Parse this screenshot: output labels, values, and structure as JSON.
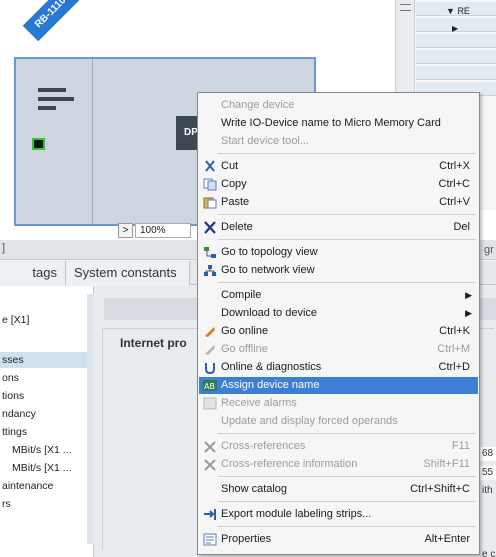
{
  "device_view": {
    "badge": "RB-1110",
    "dp_chip": "DP-",
    "zoom": {
      "next_icon": ">",
      "value": "100%"
    }
  },
  "overview": {
    "header_text": "RE",
    "header_icon": "triangle-down",
    "row_icon": "triangle-right"
  },
  "inspector": {
    "top_mark": "]",
    "right_mark": "gr",
    "tabs": [
      {
        "label": "tags"
      },
      {
        "label": "System constants"
      }
    ],
    "nav": {
      "items": [
        {
          "label": "e [X1]"
        },
        {
          "label": "sses"
        },
        {
          "label": "ons"
        },
        {
          "label": "tions"
        },
        {
          "label": "ndancy"
        },
        {
          "label": "ttings"
        },
        {
          "label": "MBit/s [X1 ..."
        },
        {
          "label": "MBit/s [X1 ..."
        },
        {
          "label": "aintenance"
        },
        {
          "label": "rs"
        }
      ]
    },
    "content": {
      "section_title": "Internet pro",
      "right_fragments": [
        "68",
        "55",
        "ith",
        "e c"
      ]
    }
  },
  "context_menu": {
    "items": [
      {
        "label": "Change device",
        "enabled": false
      },
      {
        "label": "Write IO-Device name to Micro Memory Card",
        "enabled": true
      },
      {
        "label": "Start device tool...",
        "enabled": false
      },
      {
        "label": "Cut",
        "shortcut": "Ctrl+X",
        "icon": "cut-icon",
        "enabled": true
      },
      {
        "label": "Copy",
        "shortcut": "Ctrl+C",
        "icon": "copy-icon",
        "enabled": true
      },
      {
        "label": "Paste",
        "shortcut": "Ctrl+V",
        "icon": "paste-icon",
        "enabled": true
      },
      {
        "label": "Delete",
        "shortcut": "Del",
        "icon": "delete-icon",
        "enabled": true
      },
      {
        "label": "Go to topology view",
        "icon": "topology-icon",
        "enabled": true
      },
      {
        "label": "Go to network view",
        "icon": "network-icon",
        "enabled": true
      },
      {
        "label": "Compile",
        "submenu": true,
        "enabled": true
      },
      {
        "label": "Download to device",
        "submenu": true,
        "enabled": true
      },
      {
        "label": "Go online",
        "shortcut": "Ctrl+K",
        "icon": "go-online-icon",
        "enabled": true
      },
      {
        "label": "Go offline",
        "shortcut": "Ctrl+M",
        "icon": "go-offline-icon",
        "enabled": false
      },
      {
        "label": "Online & diagnostics",
        "shortcut": "Ctrl+D",
        "icon": "diagnostics-icon",
        "enabled": true
      },
      {
        "label": "Assign device name",
        "icon": "assign-name-icon",
        "enabled": true,
        "highlighted": true
      },
      {
        "label": "Receive alarms",
        "icon": "alarm-icon",
        "enabled": false
      },
      {
        "label": "Update and display forced operands",
        "enabled": false
      },
      {
        "label": "Cross-references",
        "shortcut": "F11",
        "icon": "cross-ref-icon",
        "enabled": false
      },
      {
        "label": "Cross-reference information",
        "shortcut": "Shift+F11",
        "icon": "cross-ref-info-icon",
        "enabled": false
      },
      {
        "label": "Show catalog",
        "shortcut": "Ctrl+Shift+C",
        "enabled": true
      },
      {
        "label": "Export module labeling strips...",
        "icon": "export-icon",
        "enabled": true
      },
      {
        "label": "Properties",
        "shortcut": "Alt+Enter",
        "icon": "properties-icon",
        "enabled": true
      }
    ]
  },
  "colors": {
    "highlight": "#3d7fd6",
    "device_border": "#6d96d6",
    "badge": "#2a78d6",
    "led_border": "#2fc62f"
  }
}
